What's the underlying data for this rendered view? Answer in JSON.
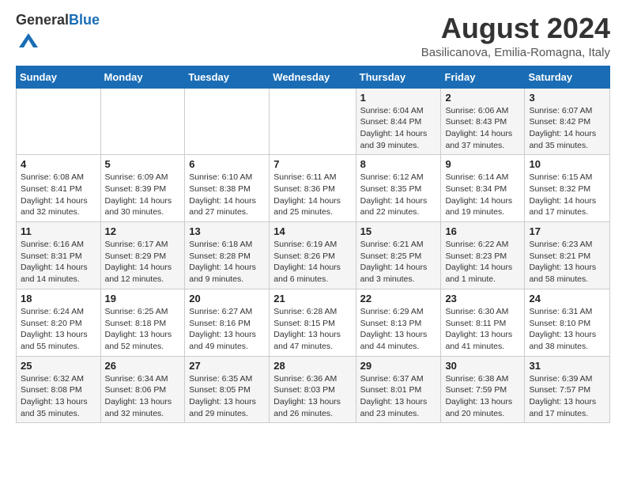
{
  "header": {
    "logo_general": "General",
    "logo_blue": "Blue",
    "month_year": "August 2024",
    "location": "Basilicanova, Emilia-Romagna, Italy"
  },
  "calendar": {
    "days_of_week": [
      "Sunday",
      "Monday",
      "Tuesday",
      "Wednesday",
      "Thursday",
      "Friday",
      "Saturday"
    ],
    "weeks": [
      [
        {
          "day": "",
          "info": ""
        },
        {
          "day": "",
          "info": ""
        },
        {
          "day": "",
          "info": ""
        },
        {
          "day": "",
          "info": ""
        },
        {
          "day": "1",
          "info": "Sunrise: 6:04 AM\nSunset: 8:44 PM\nDaylight: 14 hours\nand 39 minutes."
        },
        {
          "day": "2",
          "info": "Sunrise: 6:06 AM\nSunset: 8:43 PM\nDaylight: 14 hours\nand 37 minutes."
        },
        {
          "day": "3",
          "info": "Sunrise: 6:07 AM\nSunset: 8:42 PM\nDaylight: 14 hours\nand 35 minutes."
        }
      ],
      [
        {
          "day": "4",
          "info": "Sunrise: 6:08 AM\nSunset: 8:41 PM\nDaylight: 14 hours\nand 32 minutes."
        },
        {
          "day": "5",
          "info": "Sunrise: 6:09 AM\nSunset: 8:39 PM\nDaylight: 14 hours\nand 30 minutes."
        },
        {
          "day": "6",
          "info": "Sunrise: 6:10 AM\nSunset: 8:38 PM\nDaylight: 14 hours\nand 27 minutes."
        },
        {
          "day": "7",
          "info": "Sunrise: 6:11 AM\nSunset: 8:36 PM\nDaylight: 14 hours\nand 25 minutes."
        },
        {
          "day": "8",
          "info": "Sunrise: 6:12 AM\nSunset: 8:35 PM\nDaylight: 14 hours\nand 22 minutes."
        },
        {
          "day": "9",
          "info": "Sunrise: 6:14 AM\nSunset: 8:34 PM\nDaylight: 14 hours\nand 19 minutes."
        },
        {
          "day": "10",
          "info": "Sunrise: 6:15 AM\nSunset: 8:32 PM\nDaylight: 14 hours\nand 17 minutes."
        }
      ],
      [
        {
          "day": "11",
          "info": "Sunrise: 6:16 AM\nSunset: 8:31 PM\nDaylight: 14 hours\nand 14 minutes."
        },
        {
          "day": "12",
          "info": "Sunrise: 6:17 AM\nSunset: 8:29 PM\nDaylight: 14 hours\nand 12 minutes."
        },
        {
          "day": "13",
          "info": "Sunrise: 6:18 AM\nSunset: 8:28 PM\nDaylight: 14 hours\nand 9 minutes."
        },
        {
          "day": "14",
          "info": "Sunrise: 6:19 AM\nSunset: 8:26 PM\nDaylight: 14 hours\nand 6 minutes."
        },
        {
          "day": "15",
          "info": "Sunrise: 6:21 AM\nSunset: 8:25 PM\nDaylight: 14 hours\nand 3 minutes."
        },
        {
          "day": "16",
          "info": "Sunrise: 6:22 AM\nSunset: 8:23 PM\nDaylight: 14 hours\nand 1 minute."
        },
        {
          "day": "17",
          "info": "Sunrise: 6:23 AM\nSunset: 8:21 PM\nDaylight: 13 hours\nand 58 minutes."
        }
      ],
      [
        {
          "day": "18",
          "info": "Sunrise: 6:24 AM\nSunset: 8:20 PM\nDaylight: 13 hours\nand 55 minutes."
        },
        {
          "day": "19",
          "info": "Sunrise: 6:25 AM\nSunset: 8:18 PM\nDaylight: 13 hours\nand 52 minutes."
        },
        {
          "day": "20",
          "info": "Sunrise: 6:27 AM\nSunset: 8:16 PM\nDaylight: 13 hours\nand 49 minutes."
        },
        {
          "day": "21",
          "info": "Sunrise: 6:28 AM\nSunset: 8:15 PM\nDaylight: 13 hours\nand 47 minutes."
        },
        {
          "day": "22",
          "info": "Sunrise: 6:29 AM\nSunset: 8:13 PM\nDaylight: 13 hours\nand 44 minutes."
        },
        {
          "day": "23",
          "info": "Sunrise: 6:30 AM\nSunset: 8:11 PM\nDaylight: 13 hours\nand 41 minutes."
        },
        {
          "day": "24",
          "info": "Sunrise: 6:31 AM\nSunset: 8:10 PM\nDaylight: 13 hours\nand 38 minutes."
        }
      ],
      [
        {
          "day": "25",
          "info": "Sunrise: 6:32 AM\nSunset: 8:08 PM\nDaylight: 13 hours\nand 35 minutes."
        },
        {
          "day": "26",
          "info": "Sunrise: 6:34 AM\nSunset: 8:06 PM\nDaylight: 13 hours\nand 32 minutes."
        },
        {
          "day": "27",
          "info": "Sunrise: 6:35 AM\nSunset: 8:05 PM\nDaylight: 13 hours\nand 29 minutes."
        },
        {
          "day": "28",
          "info": "Sunrise: 6:36 AM\nSunset: 8:03 PM\nDaylight: 13 hours\nand 26 minutes."
        },
        {
          "day": "29",
          "info": "Sunrise: 6:37 AM\nSunset: 8:01 PM\nDaylight: 13 hours\nand 23 minutes."
        },
        {
          "day": "30",
          "info": "Sunrise: 6:38 AM\nSunset: 7:59 PM\nDaylight: 13 hours\nand 20 minutes."
        },
        {
          "day": "31",
          "info": "Sunrise: 6:39 AM\nSunset: 7:57 PM\nDaylight: 13 hours\nand 17 minutes."
        }
      ]
    ]
  }
}
